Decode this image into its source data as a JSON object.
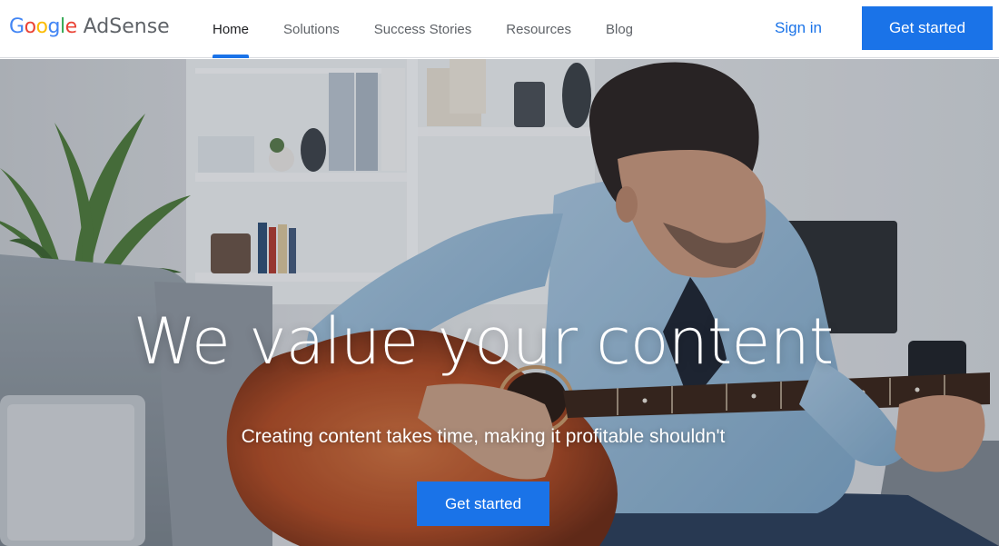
{
  "header": {
    "logo": {
      "letters": [
        "G",
        "o",
        "o",
        "g",
        "l",
        "e"
      ],
      "product": "AdSense",
      "colors": [
        "#4285f4",
        "#ea4335",
        "#fbbc05",
        "#4285f4",
        "#34a853",
        "#ea4335"
      ]
    },
    "nav": [
      {
        "label": "Home",
        "active": true
      },
      {
        "label": "Solutions",
        "active": false
      },
      {
        "label": "Success Stories",
        "active": false
      },
      {
        "label": "Resources",
        "active": false
      },
      {
        "label": "Blog",
        "active": false
      }
    ],
    "sign_in": "Sign in",
    "get_started": "Get started"
  },
  "hero": {
    "title": "We value your content",
    "subtitle": "Creating content takes time, making it profitable shouldn't",
    "cta": "Get started",
    "image": "man-playing-acoustic-guitar-on-sofa"
  },
  "colors": {
    "accent": "#1a73e8",
    "nav_text": "#5f6368",
    "nav_active": "#202124"
  }
}
